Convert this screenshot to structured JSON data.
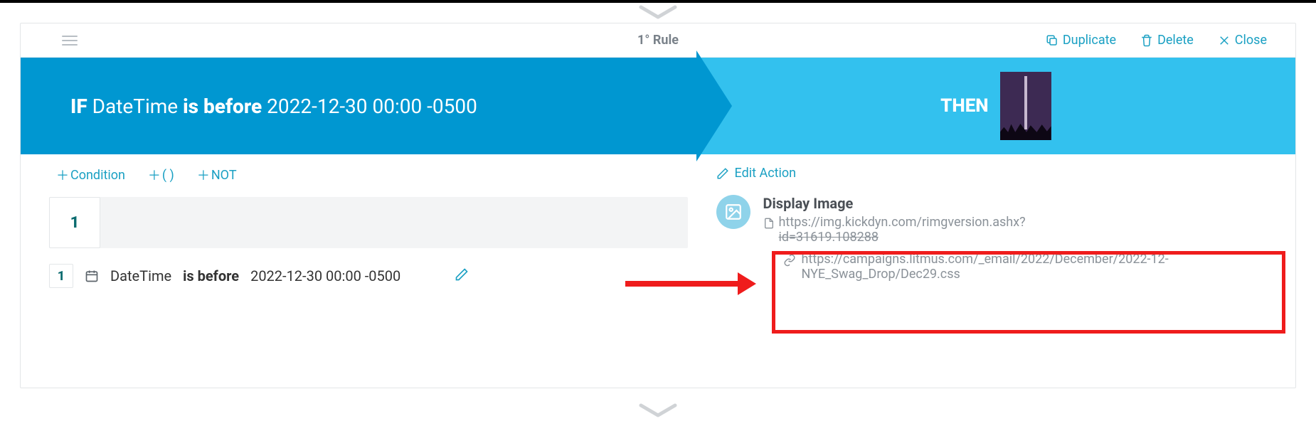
{
  "header": {
    "title": "1° Rule",
    "duplicate": "Duplicate",
    "delete": "Delete",
    "close": "Close"
  },
  "banner": {
    "if_keyword": "IF",
    "if_field": "DateTime",
    "if_operator": "is before",
    "if_value": "2022-12-30 00:00 -0500",
    "then_keyword": "THEN"
  },
  "conditions": {
    "add_condition": "Condition",
    "add_group": "( )",
    "add_not": "NOT",
    "stage_index": "1",
    "row": {
      "index": "1",
      "field": "DateTime",
      "operator": "is before",
      "value": "2022-12-30 00:00 -0500"
    }
  },
  "actions": {
    "edit_label": "Edit Action",
    "title": "Display Image",
    "image_url": "https://img.kickdyn.com/rimgversion.ashx?",
    "image_id_label": "id=31619.108288",
    "link_url": "https://campaigns.litmus.com/_email/2022/December/2022-12-NYE_Swag_Drop/Dec29.css"
  }
}
